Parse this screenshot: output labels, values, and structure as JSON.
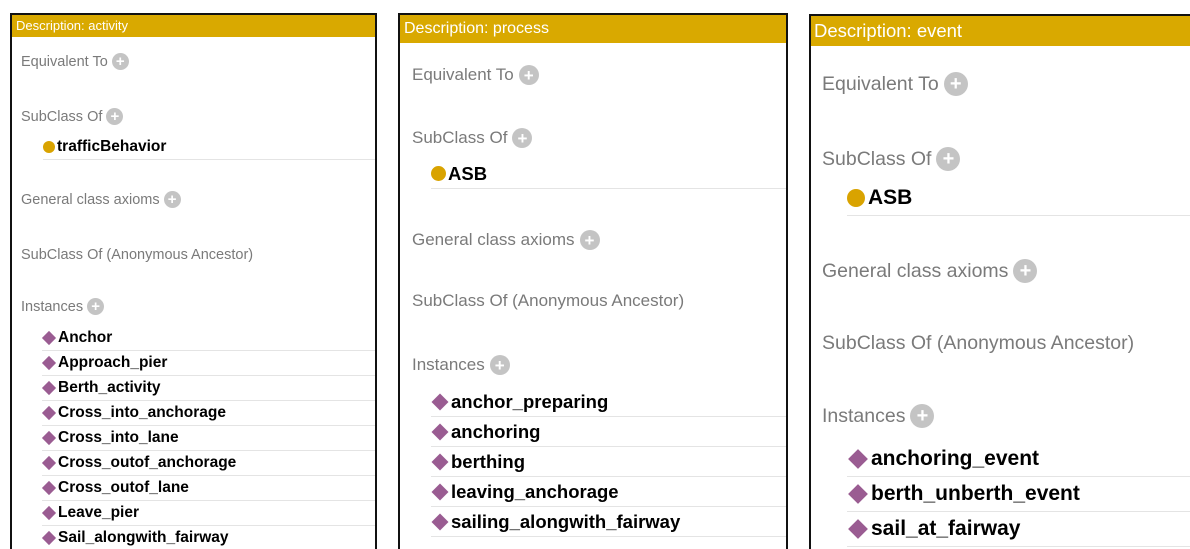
{
  "panels": [
    {
      "header": "Description: activity",
      "equivalent_to": "Equivalent To",
      "subclass_of": "SubClass Of",
      "superclasses": [
        "trafficBehavior"
      ],
      "general_axioms": "General class axioms",
      "anonymous_ancestor": "SubClass Of (Anonymous Ancestor)",
      "instances_label": "Instances",
      "instances": [
        "Anchor",
        "Approach_pier",
        "Berth_activity",
        "Cross_into_anchorage",
        "Cross_into_lane",
        "Cross_outof_anchorage",
        "Cross_outof_lane",
        "Leave_pier",
        "Sail_alongwith_fairway"
      ]
    },
    {
      "header": "Description: process",
      "equivalent_to": "Equivalent To",
      "subclass_of": "SubClass Of",
      "superclasses": [
        "ASB"
      ],
      "general_axioms": "General class axioms",
      "anonymous_ancestor": "SubClass Of (Anonymous Ancestor)",
      "instances_label": "Instances",
      "instances": [
        "anchor_preparing",
        "anchoring",
        "berthing",
        "leaving_anchorage",
        "sailing_alongwith_fairway"
      ]
    },
    {
      "header": "Description: event",
      "equivalent_to": "Equivalent To",
      "subclass_of": "SubClass Of",
      "superclasses": [
        "ASB"
      ],
      "general_axioms": "General class axioms",
      "anonymous_ancestor": "SubClass Of (Anonymous Ancestor)",
      "instances_label": "Instances",
      "instances": [
        "anchoring_event",
        "berth_unberth_event",
        "sail_at_fairway"
      ]
    }
  ],
  "icons": {
    "add": "plus-circle-icon",
    "class": "class-dot-icon",
    "instance": "instance-diamond-icon"
  },
  "add_symbol": "+",
  "colors": {
    "header_bg": "#d9a900",
    "header_text": "#ffffff",
    "label_text": "#7a7a7a",
    "add_button": "#c4c4c4",
    "class_dot": "#d9a300",
    "instance_diamond": "#9a5c92"
  }
}
